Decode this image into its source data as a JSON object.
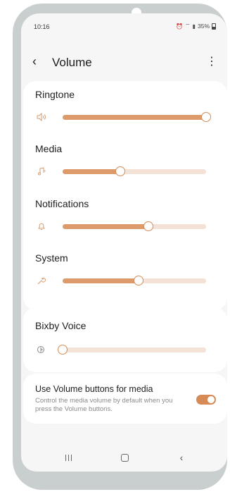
{
  "status_bar": {
    "time": "10:16",
    "battery": "35%"
  },
  "header": {
    "title": "Volume",
    "back_icon": "chevron-left-icon",
    "more_icon": "more-vertical-icon"
  },
  "volumes": [
    {
      "label": "Ringtone",
      "icon": "speaker-icon",
      "level": 1.0
    },
    {
      "label": "Media",
      "icon": "music-note-icon",
      "level": 0.4
    },
    {
      "label": "Notifications",
      "icon": "bell-icon",
      "level": 0.6
    },
    {
      "label": "System",
      "icon": "wrench-icon",
      "level": 0.53
    }
  ],
  "bixby": {
    "label": "Bixby Voice",
    "icon": "bixby-icon",
    "level": 0.0
  },
  "media_toggle": {
    "title": "Use Volume buttons for media",
    "description": "Control the media volume by default when you press the Volume buttons.",
    "on": true
  },
  "colors": {
    "accent": "#dd9a6b",
    "track": "#f4e2d6",
    "background": "#f6f6f6",
    "frame": "#c9cfcf"
  }
}
